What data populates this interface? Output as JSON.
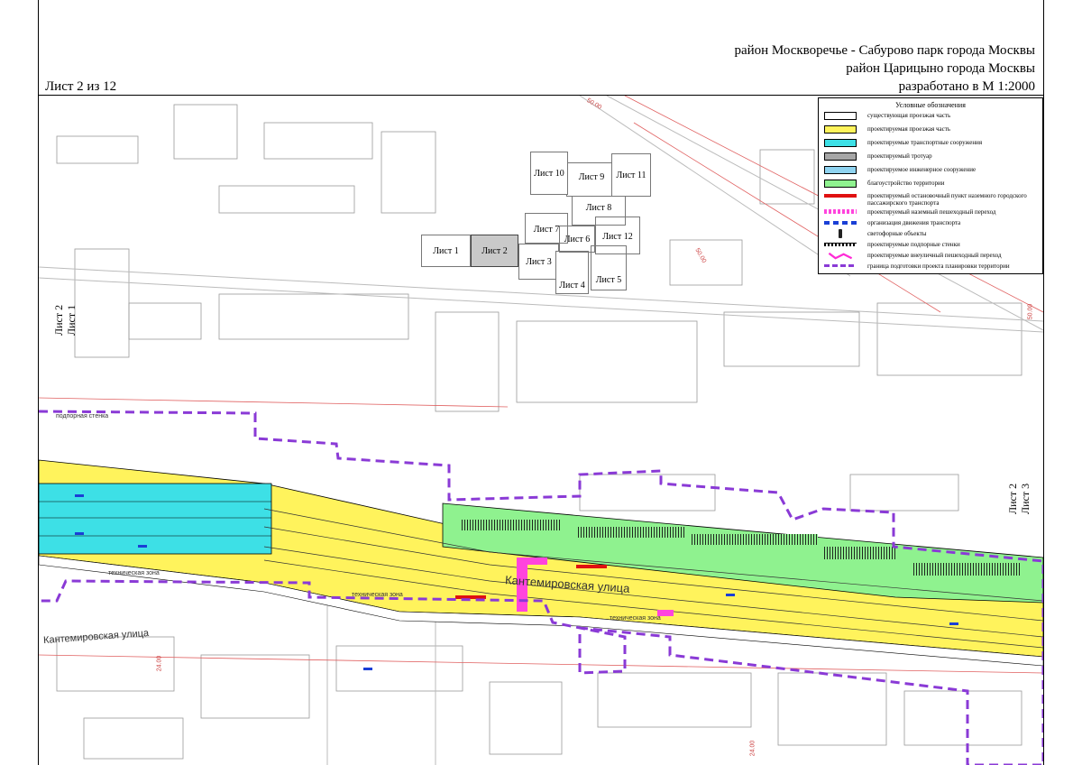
{
  "header": {
    "line1": "район Москворечье - Сабурово парк города Москвы",
    "line2": "район Царицыно города Москвы",
    "line3": "разработано в М 1:2000",
    "sheet": "Лист 2 из 12"
  },
  "legend": {
    "title": "Условные обозначения",
    "items": [
      {
        "label": "существующая проезжая часть",
        "swatch": "#ffffff",
        "border": "#000000",
        "icon": "outline-box"
      },
      {
        "label": "проектируемая проезжая часть",
        "swatch": "#fff35c",
        "border": "#000000",
        "icon": "fill-box"
      },
      {
        "label": "проектируемые транспортные сооружения",
        "swatch": "#3de0e6",
        "border": "#000000",
        "icon": "fill-box"
      },
      {
        "label": "проектируемый тротуар",
        "swatch": "#a6a6a6",
        "border": "#000000",
        "icon": "fill-box"
      },
      {
        "label": "проектируемое инженерное сооружение",
        "swatch": "#8fd3f0",
        "border": "#000000",
        "icon": "fill-box"
      },
      {
        "label": "благоустройство территории",
        "swatch": "#8ff28f",
        "border": "#000000",
        "icon": "fill-box"
      },
      {
        "label": "проектируемый остановочный пункт наземного городского пассажирского транспорта",
        "swatch": "#e01010",
        "border": "none",
        "icon": "red-bar"
      },
      {
        "label": "проектируемый наземный пешеходный переход",
        "swatch": "#ff44dd",
        "border": "none",
        "icon": "crossing"
      },
      {
        "label": "организация движения транспорта",
        "swatch": "#1a3fd6",
        "border": "none",
        "icon": "traffic-arrows"
      },
      {
        "label": "светофорные объекты",
        "swatch": "#222222",
        "border": "none",
        "icon": "traffic-light"
      },
      {
        "label": "проектируемые подпорные стенки",
        "swatch": "#000000",
        "border": "none",
        "icon": "retaining-wall"
      },
      {
        "label": "проектируемые внеуличный пешеходный переход",
        "swatch": "#ff2bd6",
        "border": "none",
        "icon": "underpass"
      },
      {
        "label": "граница подготовки проекта планировки территории",
        "swatch": "#8a3ad6",
        "border": "none",
        "icon": "dashed-boundary"
      }
    ]
  },
  "key_map": {
    "sheets": [
      {
        "label": "Лист 1",
        "active": false
      },
      {
        "label": "Лист 2",
        "active": true
      },
      {
        "label": "Лист 3",
        "active": false
      },
      {
        "label": "Лист 4",
        "active": false
      },
      {
        "label": "Лист 5",
        "active": false
      },
      {
        "label": "Лист 6",
        "active": false
      },
      {
        "label": "Лист 7",
        "active": false
      },
      {
        "label": "Лист 8",
        "active": false
      },
      {
        "label": "Лист 9",
        "active": false
      },
      {
        "label": "Лист 10",
        "active": false
      },
      {
        "label": "Лист 11",
        "active": false
      },
      {
        "label": "Лист 12",
        "active": false
      }
    ]
  },
  "map": {
    "street_name": "Кантемировская улица",
    "street_name_left": "Кантемировская улица",
    "left_sheet_label": "Лист 2",
    "left_sheet_label2": "Лист 1",
    "right_sheet_label": "Лист 2",
    "right_sheet_label2": "Лист 3",
    "retaining_wall_label": "подпорная стенка",
    "tech_zone_1": "техническая зона",
    "tech_zone_2": "техническая зона",
    "tech_zone_3": "техническая зона",
    "road_value_1": "50.00",
    "road_value_2": "50.00",
    "road_value_3": "50.00",
    "road_value_4": "24.00",
    "road_value_5": "24.00",
    "colors": {
      "yellow": "#fff35c",
      "cyan": "#3de0e6",
      "green": "#8ff28f",
      "boundary": "#8a3ad6",
      "crossing": "#ff44dd",
      "stop": "#e01010",
      "building": "#9a9a9a",
      "redline": "#e06060"
    }
  }
}
